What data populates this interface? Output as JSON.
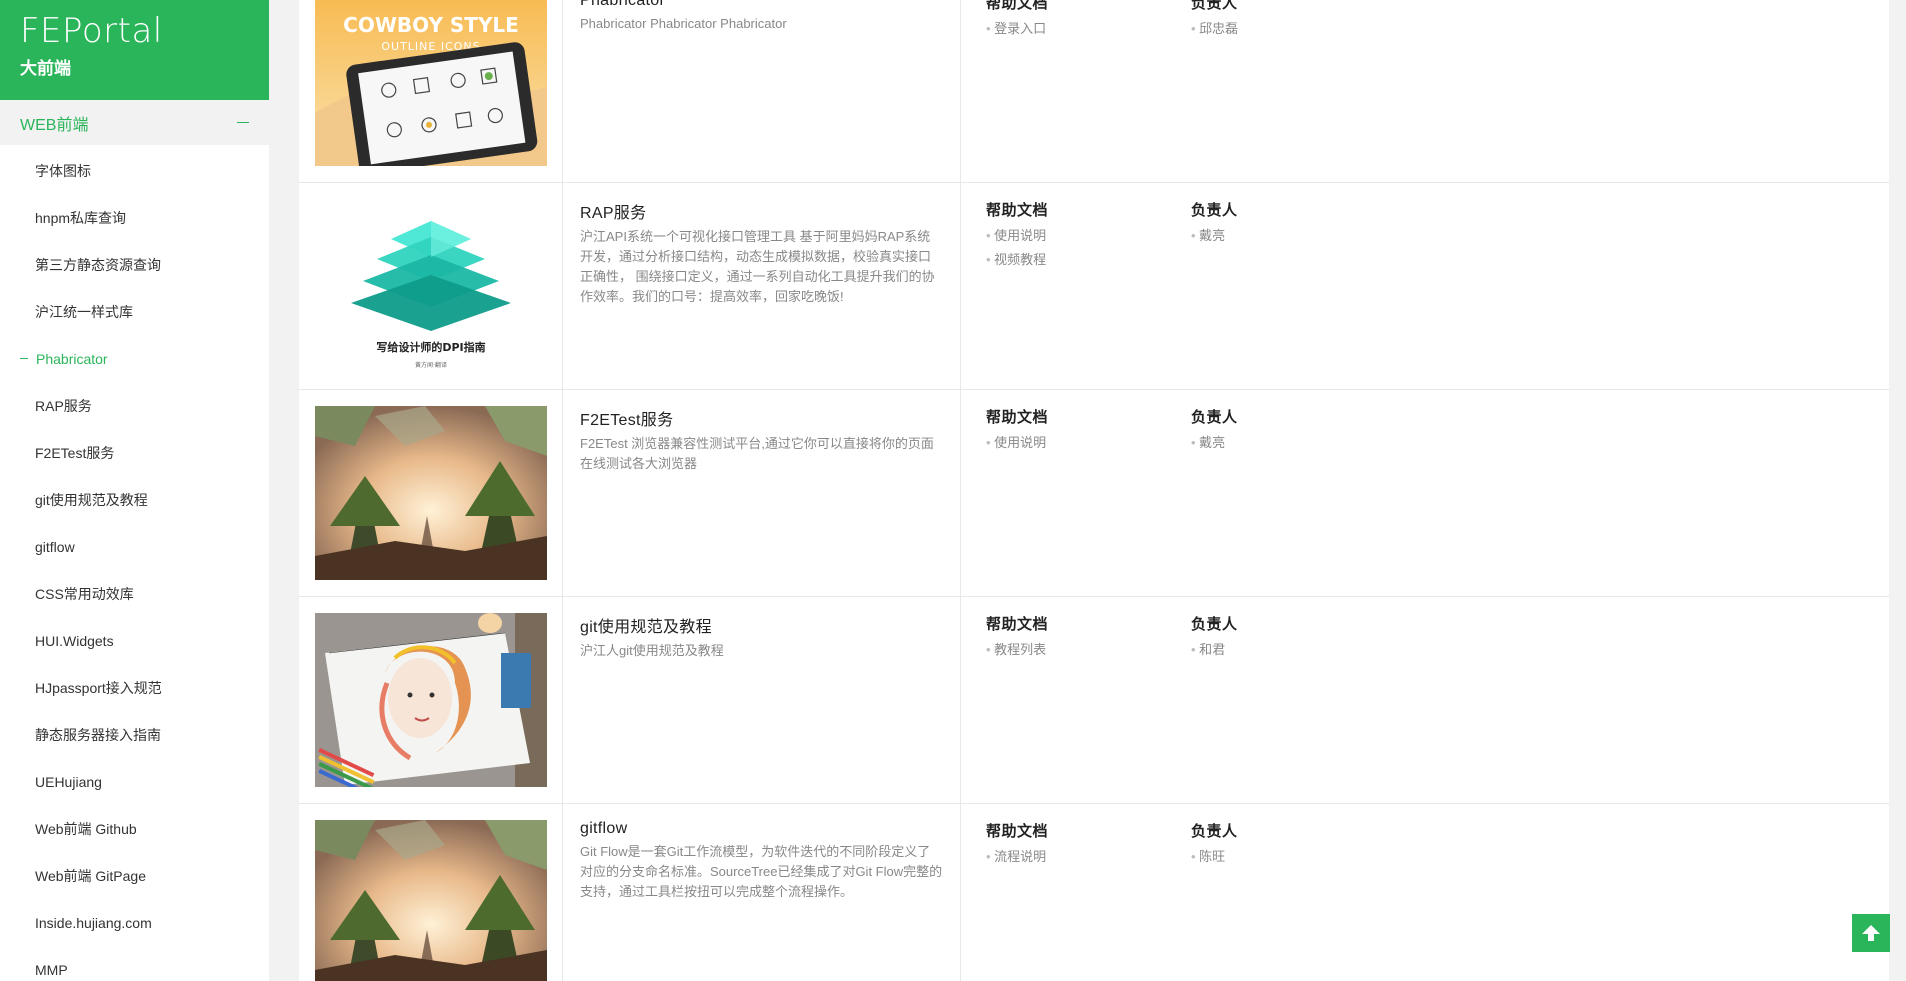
{
  "brand": {
    "title": "FEPortal",
    "subtitle": "大前端"
  },
  "sidebar": {
    "section": "WEB前端",
    "items": [
      {
        "label": "字体图标"
      },
      {
        "label": "hnpm私库查询"
      },
      {
        "label": "第三方静态资源查询"
      },
      {
        "label": "沪江统一样式库"
      },
      {
        "label": "Phabricator",
        "active": true
      },
      {
        "label": "RAP服务"
      },
      {
        "label": "F2ETest服务"
      },
      {
        "label": "git使用规范及教程"
      },
      {
        "label": "gitflow"
      },
      {
        "label": "CSS常用动效库"
      },
      {
        "label": "HUI.Widgets"
      },
      {
        "label": "HJpassport接入规范"
      },
      {
        "label": "静态服务器接入指南"
      },
      {
        "label": "UEHujiang"
      },
      {
        "label": "Web前端 Github"
      },
      {
        "label": "Web前端 GitPage"
      },
      {
        "label": "Inside.hujiang.com"
      },
      {
        "label": "MMP"
      }
    ]
  },
  "columns": {
    "help": "帮助文档",
    "owner": "负责人"
  },
  "cards": [
    {
      "title": "Phabricator",
      "desc": "Phabricator Phabricator Phabricator",
      "image": {
        "line1": "COWBOY STYLE",
        "line2": "OUTLINE ICONS"
      },
      "help": [
        "登录入口"
      ],
      "owner": [
        "邱忠磊"
      ]
    },
    {
      "title": "RAP服务",
      "desc": "沪江API系统一个可视化接口管理工具 基于阿里妈妈RAP系统开发，通过分析接口结构，动态生成模拟数据，校验真实接口正确性， 围绕接口定义，通过一系列自动化工具提升我们的协作效率。我们的口号：提高效率，回家吃晚饭!",
      "image": {
        "caption": "写给设计师的DPI指南",
        "byline": "黄方闻·翻译"
      },
      "help": [
        "使用说明",
        "视频教程"
      ],
      "owner": [
        "戴亮"
      ]
    },
    {
      "title": "F2ETest服务",
      "desc": "F2ETest 浏览器兼容性测试平台,通过它你可以直接将你的页面在线测试各大浏览器",
      "help": [
        "使用说明"
      ],
      "owner": [
        "戴亮"
      ]
    },
    {
      "title": "git使用规范及教程",
      "desc": "沪江人git使用规范及教程",
      "help": [
        "教程列表"
      ],
      "owner": [
        "和君"
      ]
    },
    {
      "title": "gitflow",
      "desc": "Git Flow是一套Git工作流模型，为软件迭代的不同阶段定义了对应的分支命名标准。SourceTree已经集成了对Git Flow完整的支持，通过工具栏按扭可以完成整个流程操作。",
      "help": [
        "流程说明"
      ],
      "owner": [
        "陈旺"
      ]
    }
  ]
}
